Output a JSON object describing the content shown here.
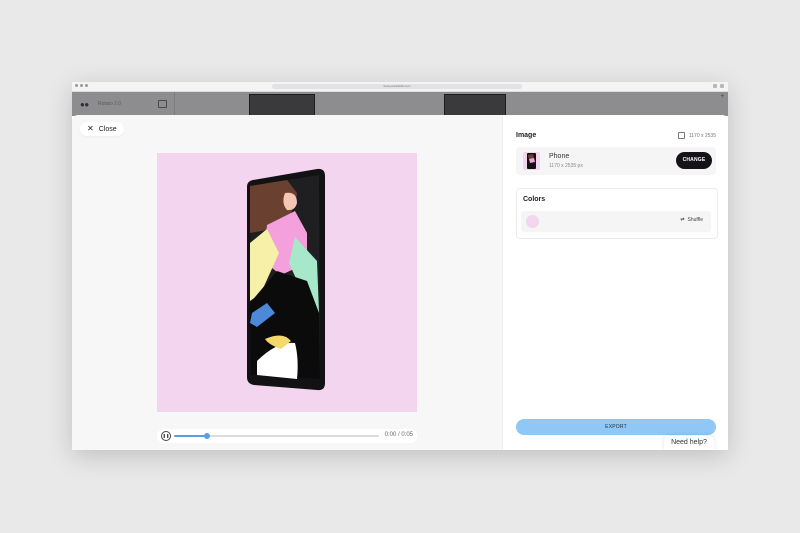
{
  "browser": {
    "url": "beta.pixelrabbit.com"
  },
  "appbar": {
    "logo": "●●",
    "workspace": "Rotato 2.0"
  },
  "modal": {
    "close_label": "Close",
    "player": {
      "time": "0:00 / 0:05",
      "progress": 0.16
    }
  },
  "panel": {
    "image": {
      "title": "Image",
      "dimensions": "1170 x 2535",
      "name": "Phone",
      "size": "1170 x 2535 px",
      "change_label": "CHANGE"
    },
    "colors": {
      "title": "Colors",
      "swatch_color": "#f4d5ef",
      "shuffle_label": "Shuffle"
    },
    "export_label": "EXPORT"
  },
  "help": {
    "label": "Need help?"
  },
  "colors": {
    "canvas_bg": "#f4d5ef",
    "accent": "#5b9ee3",
    "export_bg": "#8fc8f6"
  }
}
